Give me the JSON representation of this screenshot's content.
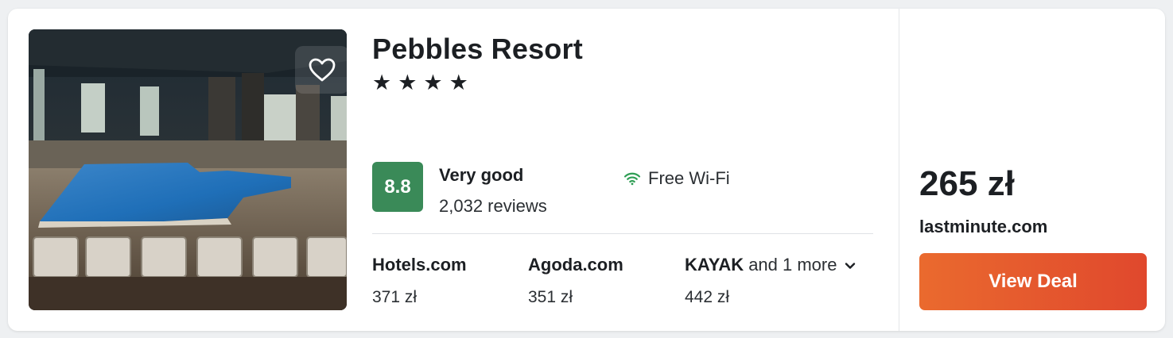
{
  "hotel": {
    "name": "Pebbles Resort",
    "stars_text": "★★★★",
    "star_count": 4,
    "photo_icon": "indoor-pool-photo",
    "favorite_icon": "heart-outline-icon"
  },
  "rating": {
    "score": "8.8",
    "label": "Very good",
    "reviews": "2,032 reviews",
    "score_color": "#3a8a58"
  },
  "amenity": {
    "icon": "wifi-icon",
    "label": "Free Wi-Fi",
    "icon_color": "#2f9e55"
  },
  "providers": [
    {
      "name": "Hotels.com",
      "price": "371 zł"
    },
    {
      "name": "Agoda.com",
      "price": "351 zł"
    },
    {
      "name": "KAYAK",
      "more": "and 1 more",
      "price": "442 zł"
    }
  ],
  "deal": {
    "price": "265 zł",
    "seller": "lastminute.com",
    "button_label": "View Deal",
    "button_color": "#e55a2c"
  }
}
